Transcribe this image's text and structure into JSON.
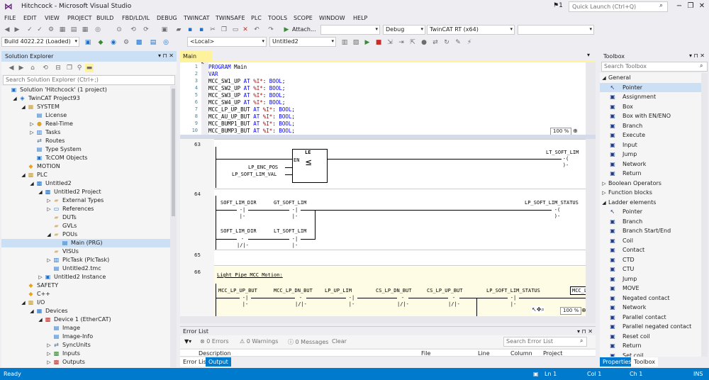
{
  "window": {
    "title": "Hitchcock - Microsoft Visual Studio",
    "notification_count": "1",
    "quick_launch_placeholder": "Quick Launch (Ctrl+Q)"
  },
  "menu": [
    "FILE",
    "EDIT",
    "VIEW",
    "PROJECT",
    "BUILD",
    "FBD/LD/IL",
    "DEBUG",
    "TWINCAT",
    "TWINSAFE",
    "PLC",
    "TOOLS",
    "SCOPE",
    "WINDOW",
    "HELP"
  ],
  "toolbar": {
    "attach_label": "Attach...",
    "config": "Debug",
    "platform": "TwinCAT RT (x64)",
    "build_version": "Build 4022.22 (Loaded)",
    "target": "<Local>",
    "project": "Untitled2"
  },
  "solution_explorer": {
    "title": "Solution Explorer",
    "search_placeholder": "Search Solution Explorer (Ctrl+;)",
    "items": [
      {
        "label": "Solution 'Hitchcock' (1 project)",
        "indent": 0,
        "icon": "solution-icon",
        "arrow": ""
      },
      {
        "label": "TwinCAT Project93",
        "indent": 1,
        "icon": "twincat-project-icon",
        "arrow": "◢"
      },
      {
        "label": "SYSTEM",
        "indent": 2,
        "icon": "system-icon",
        "arrow": "◢"
      },
      {
        "label": "License",
        "indent": 3,
        "icon": "license-icon",
        "arrow": ""
      },
      {
        "label": "Real-Time",
        "indent": 3,
        "icon": "realtime-icon",
        "arrow": "▷"
      },
      {
        "label": "Tasks",
        "indent": 3,
        "icon": "tasks-icon",
        "arrow": "▷"
      },
      {
        "label": "Routes",
        "indent": 3,
        "icon": "routes-icon",
        "arrow": ""
      },
      {
        "label": "Type System",
        "indent": 3,
        "icon": "type-system-icon",
        "arrow": ""
      },
      {
        "label": "TcCOM Objects",
        "indent": 3,
        "icon": "tccom-icon",
        "arrow": ""
      },
      {
        "label": "MOTION",
        "indent": 2,
        "icon": "motion-icon",
        "arrow": ""
      },
      {
        "label": "PLC",
        "indent": 2,
        "icon": "plc-icon",
        "arrow": "◢"
      },
      {
        "label": "Untitled2",
        "indent": 3,
        "icon": "plc-project-icon",
        "arrow": "◢"
      },
      {
        "label": "Untitled2 Project",
        "indent": 4,
        "icon": "plc-project-icon",
        "arrow": "◢"
      },
      {
        "label": "External Types",
        "indent": 5,
        "icon": "folder-icon",
        "arrow": "▷"
      },
      {
        "label": "References",
        "indent": 5,
        "icon": "references-icon",
        "arrow": "▷"
      },
      {
        "label": "DUTs",
        "indent": 5,
        "icon": "folder-icon",
        "arrow": ""
      },
      {
        "label": "GVLs",
        "indent": 5,
        "icon": "folder-icon",
        "arrow": ""
      },
      {
        "label": "POUs",
        "indent": 5,
        "icon": "folder-icon",
        "arrow": "◢"
      },
      {
        "label": "Main (PRG)",
        "indent": 6,
        "icon": "program-icon",
        "arrow": "",
        "selected": true
      },
      {
        "label": "VISUs",
        "indent": 5,
        "icon": "folder-icon",
        "arrow": ""
      },
      {
        "label": "PlcTask (PlcTask)",
        "indent": 5,
        "icon": "task-icon",
        "arrow": "▷"
      },
      {
        "label": "Untitled2.tmc",
        "indent": 5,
        "icon": "tmc-icon",
        "arrow": ""
      },
      {
        "label": "Untitled2 Instance",
        "indent": 4,
        "icon": "instance-icon",
        "arrow": "▷"
      },
      {
        "label": "SAFETY",
        "indent": 2,
        "icon": "safety-icon",
        "arrow": ""
      },
      {
        "label": "C++",
        "indent": 2,
        "icon": "cpp-icon",
        "arrow": ""
      },
      {
        "label": "I/O",
        "indent": 2,
        "icon": "io-icon",
        "arrow": "◢"
      },
      {
        "label": "Devices",
        "indent": 3,
        "icon": "devices-icon",
        "arrow": "◢"
      },
      {
        "label": "Device 1 (EtherCAT)",
        "indent": 4,
        "icon": "ethercat-icon",
        "arrow": "◢"
      },
      {
        "label": "Image",
        "indent": 5,
        "icon": "image-icon",
        "arrow": ""
      },
      {
        "label": "Image-Info",
        "indent": 5,
        "icon": "image-info-icon",
        "arrow": ""
      },
      {
        "label": "SyncUnits",
        "indent": 5,
        "icon": "syncunits-icon",
        "arrow": "▷"
      },
      {
        "label": "Inputs",
        "indent": 5,
        "icon": "inputs-icon",
        "arrow": "▷"
      },
      {
        "label": "Outputs",
        "indent": 5,
        "icon": "outputs-icon",
        "arrow": "▷"
      }
    ]
  },
  "editor": {
    "tab_label": "Main",
    "code_lines": [
      {
        "n": "1",
        "parts": [
          [
            "kw",
            "PROGRAM"
          ],
          [
            "v",
            " Main"
          ]
        ]
      },
      {
        "n": "2",
        "parts": [
          [
            "kw",
            "VAR"
          ]
        ]
      },
      {
        "n": "3",
        "parts": [
          [
            "v",
            "    MCC_SW1_UP "
          ],
          [
            "kw",
            "AT"
          ],
          [
            "addr",
            " %I*"
          ],
          [
            "v",
            ": "
          ],
          [
            "kw",
            "BOOL"
          ],
          [
            "v",
            ";"
          ]
        ]
      },
      {
        "n": "4",
        "parts": [
          [
            "v",
            "    MCC_SW2_UP "
          ],
          [
            "kw",
            "AT"
          ],
          [
            "addr",
            " %I*"
          ],
          [
            "v",
            ": "
          ],
          [
            "kw",
            "BOOL"
          ],
          [
            "v",
            ";"
          ]
        ]
      },
      {
        "n": "5",
        "parts": [
          [
            "v",
            "    MCC_SW3_UP "
          ],
          [
            "kw",
            "AT"
          ],
          [
            "addr",
            " %I*"
          ],
          [
            "v",
            ": "
          ],
          [
            "kw",
            "BOOL"
          ],
          [
            "v",
            ";"
          ]
        ]
      },
      {
        "n": "6",
        "parts": [
          [
            "v",
            "    MCC_SW4_UP "
          ],
          [
            "kw",
            "AT"
          ],
          [
            "addr",
            " %I*"
          ],
          [
            "v",
            ": "
          ],
          [
            "kw",
            "BOOL"
          ],
          [
            "v",
            ";"
          ]
        ]
      },
      {
        "n": "7",
        "parts": [
          [
            "v",
            "    MCC_LP_UP_BUT "
          ],
          [
            "kw",
            "AT"
          ],
          [
            "addr",
            " %I*"
          ],
          [
            "v",
            ": "
          ],
          [
            "kw",
            "BOOL"
          ],
          [
            "v",
            ";"
          ]
        ]
      },
      {
        "n": "8",
        "parts": [
          [
            "v",
            "    MCC_AU_UP_BUT "
          ],
          [
            "kw",
            "AT"
          ],
          [
            "addr",
            " %I*"
          ],
          [
            "v",
            ": "
          ],
          [
            "kw",
            "BOOL"
          ],
          [
            "v",
            ";"
          ]
        ]
      },
      {
        "n": "9",
        "parts": [
          [
            "v",
            "    MCC_BUMP1_BUT "
          ],
          [
            "kw",
            "AT"
          ],
          [
            "addr",
            " %I*"
          ],
          [
            "v",
            ": "
          ],
          [
            "kw",
            "BOOL"
          ],
          [
            "v",
            ";"
          ]
        ]
      },
      {
        "n": "10",
        "parts": [
          [
            "v",
            "    MCC_BUMP3_BUT "
          ],
          [
            "kw",
            "AT"
          ],
          [
            "addr",
            " %I*"
          ],
          [
            "v",
            ": "
          ],
          [
            "kw",
            "BOOL"
          ],
          [
            "v",
            ";"
          ]
        ]
      }
    ],
    "zoom": "100 %",
    "ladder": {
      "net63": {
        "num": "63",
        "block_type": "LE",
        "block_en": "EN",
        "block_symbol": "≤",
        "in1": "LP_ENC_POS",
        "in2": "LP_SOFT_LIM_VAL",
        "coil": "LT_SOFT_LIM"
      },
      "net64": {
        "num": "64",
        "c1": "SOFT_LIM_DIR",
        "c2": "GT_SOFT_LIM",
        "c3": "SOFT_LIM_DIR",
        "c4": "LT_SOFT_LIM",
        "coil": "LP_SOFT_LIM_STATUS"
      },
      "net65": {
        "num": "65"
      },
      "net66": {
        "num": "66",
        "comment": "Light_Pipe_MCC_Motion:",
        "contacts": [
          "MCC_LP_UP_BUT",
          "MCC_LP_DN_BUT",
          "LP_UP_LIM",
          "CS_LP_DN_BUT",
          "CS_LP_UP_BUT",
          "LP_SOFT_LIM_STATUS",
          "MCC_LP"
        ]
      },
      "contact_no": "-| |-",
      "contact_nc": "-|/|-",
      "coil_sym": "-( )-"
    }
  },
  "error_list": {
    "title": "Error List",
    "errors": "0 Errors",
    "warnings": "0 Warnings",
    "messages": "0 Messages",
    "clear": "Clear",
    "search_placeholder": "Search Error List",
    "columns": [
      "Description",
      "File",
      "Line",
      "Column",
      "Project"
    ],
    "tabs": [
      "Error List",
      "Output"
    ]
  },
  "toolbox": {
    "title": "Toolbox",
    "search_placeholder": "Search Toolbox",
    "items": [
      {
        "label": "General",
        "type": "group",
        "arrow": "◢"
      },
      {
        "label": "Pointer",
        "type": "item",
        "selected": true,
        "icon": "pointer-icon"
      },
      {
        "label": "Assignment",
        "type": "item",
        "icon": "assignment-icon"
      },
      {
        "label": "Box",
        "type": "item",
        "icon": "box-icon"
      },
      {
        "label": "Box with EN/ENO",
        "type": "item",
        "icon": "box-en-icon"
      },
      {
        "label": "Branch",
        "type": "item",
        "icon": "branch-icon"
      },
      {
        "label": "Execute",
        "type": "item",
        "icon": "execute-icon"
      },
      {
        "label": "Input",
        "type": "item",
        "icon": "input-icon"
      },
      {
        "label": "Jump",
        "type": "item",
        "icon": "jump-icon"
      },
      {
        "label": "Network",
        "type": "item",
        "icon": "network-icon"
      },
      {
        "label": "Return",
        "type": "item",
        "icon": "return-icon"
      },
      {
        "label": "Boolean Operators",
        "type": "group",
        "arrow": "▷"
      },
      {
        "label": "Function blocks",
        "type": "group",
        "arrow": "▷"
      },
      {
        "label": "Ladder elements",
        "type": "group",
        "arrow": "◢"
      },
      {
        "label": "Pointer",
        "type": "item",
        "icon": "pointer-icon"
      },
      {
        "label": "Branch",
        "type": "item",
        "icon": "branch-icon"
      },
      {
        "label": "Branch Start/End",
        "type": "item",
        "icon": "branch-start-end-icon"
      },
      {
        "label": "Coil",
        "type": "item",
        "icon": "coil-icon"
      },
      {
        "label": "Contact",
        "type": "item",
        "icon": "contact-icon"
      },
      {
        "label": "CTD",
        "type": "item",
        "icon": "ctd-icon"
      },
      {
        "label": "CTU",
        "type": "item",
        "icon": "ctu-icon"
      },
      {
        "label": "Jump",
        "type": "item",
        "icon": "jump-icon"
      },
      {
        "label": "MOVE",
        "type": "item",
        "icon": "move-icon"
      },
      {
        "label": "Negated contact",
        "type": "item",
        "icon": "negated-contact-icon"
      },
      {
        "label": "Network",
        "type": "item",
        "icon": "network-icon"
      },
      {
        "label": "Parallel contact",
        "type": "item",
        "icon": "parallel-contact-icon"
      },
      {
        "label": "Parallel negated contact",
        "type": "item",
        "icon": "parallel-negated-contact-icon"
      },
      {
        "label": "Reset coil",
        "type": "item",
        "icon": "reset-coil-icon"
      },
      {
        "label": "Return",
        "type": "item",
        "icon": "return-icon"
      },
      {
        "label": "Set coil",
        "type": "item",
        "icon": "set-coil-icon"
      }
    ],
    "tabs": [
      "Properties",
      "Toolbox"
    ]
  },
  "status": {
    "ready": "Ready",
    "ln": "Ln 1",
    "col": "Col 1",
    "ch": "Ch 1",
    "ins": "INS"
  },
  "colors": {
    "accent": "#007acc",
    "selection": "#cce0f5",
    "editor_tab": "#fff29d"
  }
}
